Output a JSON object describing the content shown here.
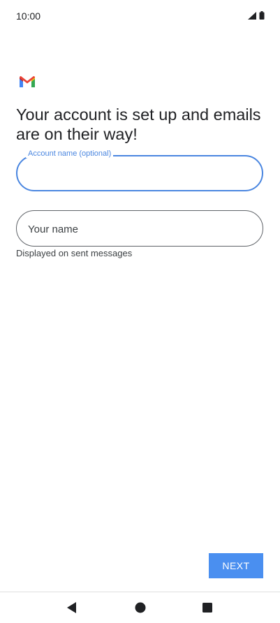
{
  "status_bar": {
    "time": "10:00",
    "icons": [
      "signal-icon",
      "battery-icon"
    ]
  },
  "app": {
    "logo_icon": "gmail-logo-icon",
    "heading": "Your account is set up and emails are on their way!"
  },
  "account_name_field": {
    "label": "Account name (optional)",
    "value": ""
  },
  "your_name_field": {
    "placeholder": "Your name",
    "value": "",
    "helper": "Displayed on sent messages"
  },
  "actions": {
    "next_label": "NEXT"
  },
  "navigation": {
    "back_icon": "back-triangle-icon",
    "home_icon": "home-circle-icon",
    "recents_icon": "recents-square-icon"
  },
  "colors": {
    "accent": "#4a86e0",
    "button": "#4a8ff0",
    "gmail_red": "#ea4335",
    "gmail_blue": "#4285f4",
    "gmail_green": "#34a853",
    "gmail_yellow": "#fbbc04"
  }
}
